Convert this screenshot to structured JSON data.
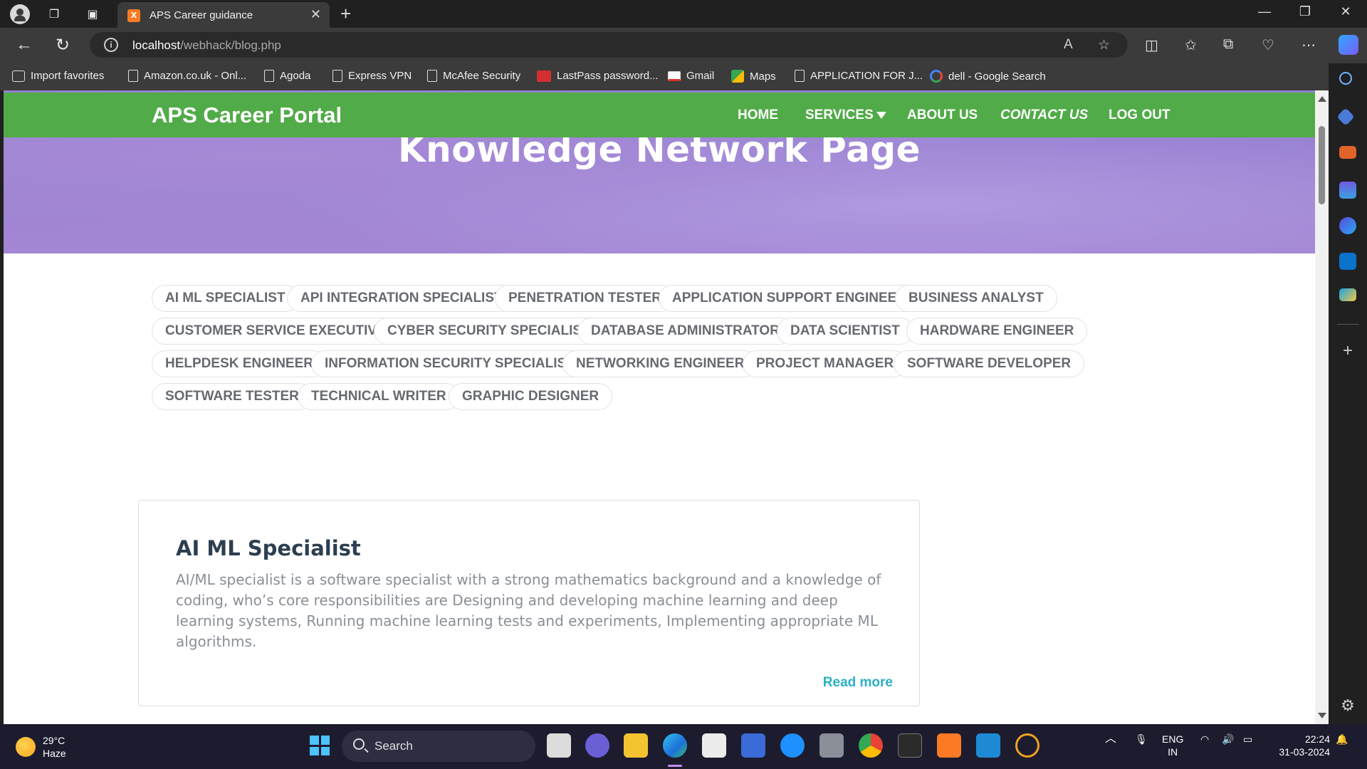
{
  "browser": {
    "tab_title": "APS Career guidance",
    "tab_favicon": "xampp-icon",
    "url_host": "localhost",
    "url_path": "/webhack/blog.php",
    "favorites": [
      {
        "label": "Import favorites",
        "icon": "import-icon"
      },
      {
        "label": "Amazon.co.uk - Onl...",
        "icon": "page-icon"
      },
      {
        "label": "Agoda",
        "icon": "page-icon"
      },
      {
        "label": "Express VPN",
        "icon": "page-icon"
      },
      {
        "label": "McAfee Security",
        "icon": "page-icon"
      },
      {
        "label": "LastPass password...",
        "icon": "lastpass-icon"
      },
      {
        "label": "Gmail",
        "icon": "gmail-icon"
      },
      {
        "label": "Maps",
        "icon": "maps-icon"
      },
      {
        "label": "APPLICATION FOR J...",
        "icon": "page-icon"
      },
      {
        "label": "dell - Google Search",
        "icon": "google-icon"
      }
    ]
  },
  "site": {
    "brand": "APS Career Portal",
    "nav": {
      "home": "HOME",
      "services": "SERVICES",
      "about": "ABOUT US",
      "contact": "CONTACT US",
      "logout": "LOG OUT"
    },
    "hero_title": "Knowledge Network Page",
    "tags": [
      "AI ML SPECIALIST",
      "API INTEGRATION SPECIALIST",
      "PENETRATION TESTER",
      "APPLICATION SUPPORT ENGINEER",
      "BUSINESS ANALYST",
      "CUSTOMER SERVICE EXECUTIVE",
      "CYBER SECURITY SPECIALIST",
      "DATABASE ADMINISTRATOR",
      "DATA SCIENTIST",
      "HARDWARE ENGINEER",
      "HELPDESK ENGINEER",
      "INFORMATION SECURITY SPECIALIST",
      "NETWORKING ENGINEER",
      "PROJECT MANAGER",
      "SOFTWARE DEVELOPER",
      "SOFTWARE TESTER",
      "TECHNICAL WRITER",
      "GRAPHIC DESIGNER"
    ],
    "card": {
      "title": "AI ML Specialist",
      "body": "AI/ML specialist is a software specialist with a strong mathematics background and a knowledge of coding, who’s core responsibilities are Designing and developing machine learning and deep learning systems, Running machine learning tests and experiments, Implementing appropriate ML algorithms.",
      "read_more": "Read more"
    }
  },
  "taskbar": {
    "temperature": "29°C",
    "condition": "Haze",
    "search": "Search",
    "lang_top": "ENG",
    "lang_bottom": "IN",
    "time": "22:24",
    "date": "31-03-2024"
  },
  "colors": {
    "nav_green": "#51ab48",
    "hero_purple": "#9b84d4",
    "link_teal": "#2bb0c4"
  }
}
